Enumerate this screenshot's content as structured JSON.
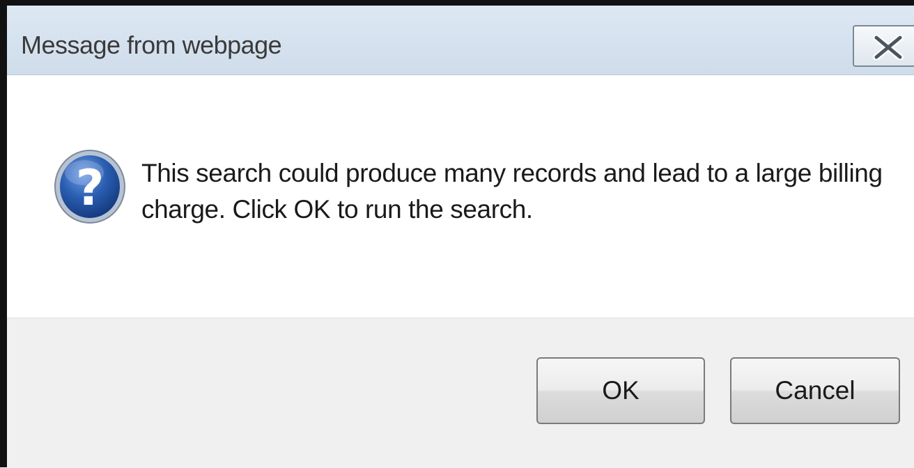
{
  "dialog": {
    "title": "Message from webpage",
    "message": "This search could produce many records and lead to a large billing\ncharge.  Click OK to run the search.",
    "icon": "question-icon",
    "close_icon": "close-icon",
    "buttons": {
      "ok_label": "OK",
      "cancel_label": "Cancel"
    }
  },
  "colors": {
    "titlebar": "#d6e2ee",
    "footer": "#f0f0f0",
    "icon_blue": "#2a5db0",
    "frame": "#111111"
  }
}
